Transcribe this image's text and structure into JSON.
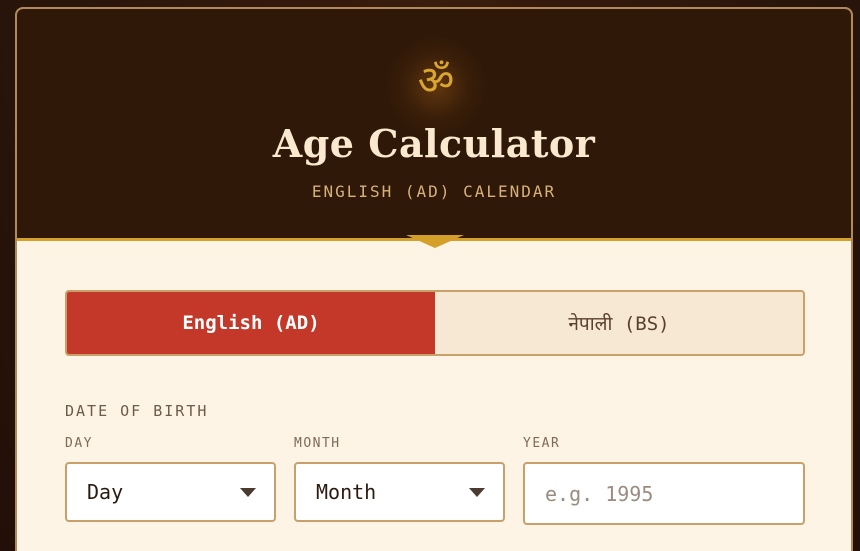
{
  "header": {
    "icon": "om-icon",
    "symbol": "ॐ",
    "title": "Age Calculator",
    "subtitle": "ENGLISH (AD) CALENDAR"
  },
  "calendar_toggle": {
    "options": [
      {
        "label": "English (AD)",
        "active": true
      },
      {
        "label": "नेपाली (BS)",
        "active": false
      }
    ]
  },
  "form": {
    "section_label": "DATE OF BIRTH",
    "day": {
      "label": "DAY",
      "value": "Day",
      "icon": "chevron-down-icon"
    },
    "month": {
      "label": "MONTH",
      "value": "Month",
      "icon": "chevron-down-icon"
    },
    "year": {
      "label": "YEAR",
      "value": "",
      "placeholder": "e.g. 1995"
    }
  },
  "colors": {
    "header_bg": "#2f1807",
    "accent_gold": "#d4a02a",
    "active_tab": "#c4382a",
    "card_bg": "#fdf4e5",
    "border": "#c9a06a"
  }
}
